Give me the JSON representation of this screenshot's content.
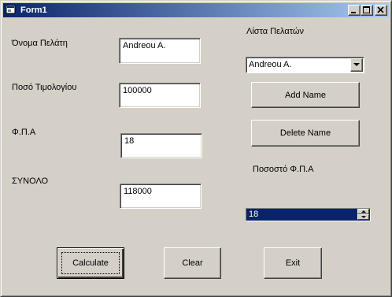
{
  "window": {
    "title": "Form1",
    "icons": {
      "app": "form-app-icon",
      "minimize": "minimize-icon",
      "maximize": "maximize-icon",
      "close": "close-icon"
    }
  },
  "form": {
    "customer_name_label": "Όνομα Πελάτη",
    "customer_name_value": "Andreou A.",
    "invoice_amount_label": "Ποσό Τιμολογίου",
    "invoice_amount_value": "100000",
    "vat_label": "Φ.Π.Α",
    "vat_value": "18",
    "total_label": "ΣΥΝΟΛΟ",
    "total_value": "118000"
  },
  "customers": {
    "list_label": "Λίστα Πελατών",
    "selected": "Andreou A.",
    "add_button": "Add Name",
    "delete_button": "Delete Name"
  },
  "vat_rate": {
    "label": "Ποσοστό Φ.Π.Α",
    "value": "18"
  },
  "actions": {
    "calculate": "Calculate",
    "clear": "Clear",
    "exit": "Exit"
  },
  "colors": {
    "titlebar_start": "#0a246a",
    "titlebar_end": "#a6caf0",
    "face": "#d4d0c8",
    "selection": "#0a246a"
  }
}
